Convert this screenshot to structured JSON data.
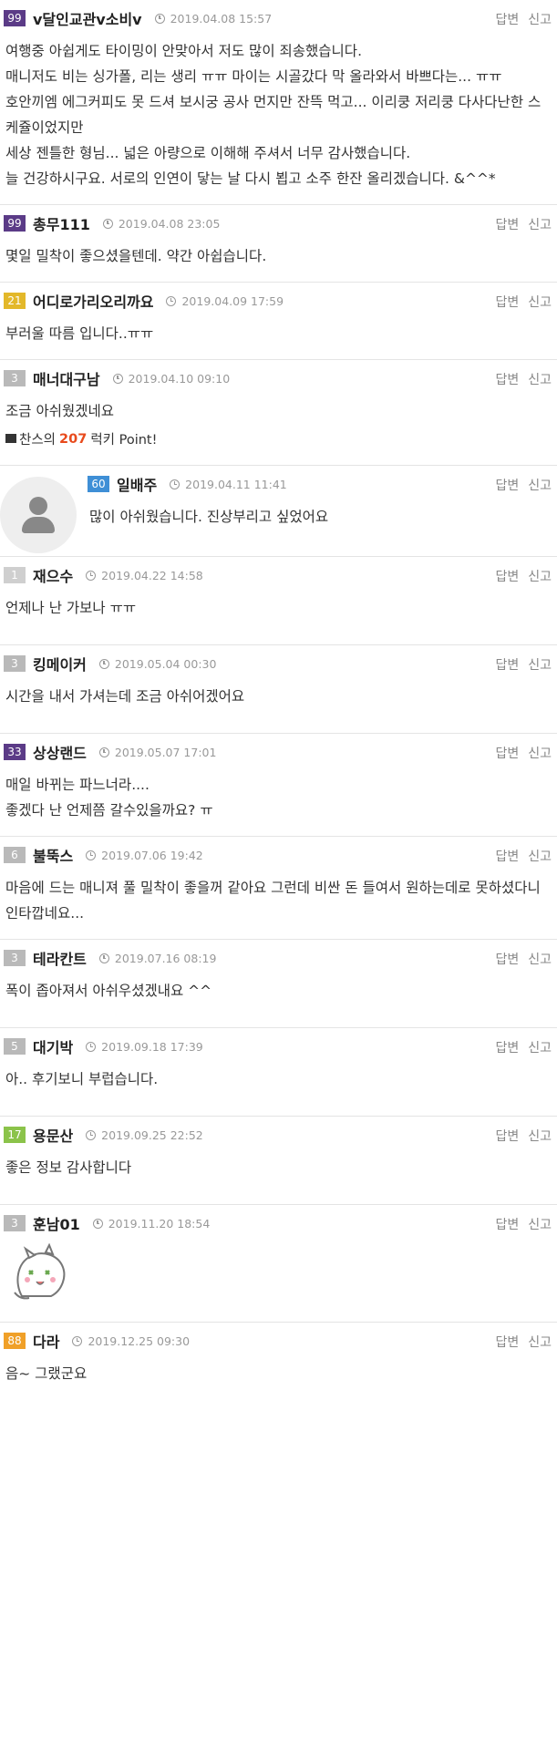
{
  "actions": {
    "reply": "답변",
    "report": "신고"
  },
  "comments": [
    {
      "level": "99",
      "nick": "v달인교관v소비v",
      "time": "2019.04.08 15:57",
      "lines": [
        "여행중 아쉽게도 타이밍이 안맞아서 저도 많이 죄송했습니다.",
        "매니저도 비는 싱가폴, 리는 생리 ㅠㅠ 마이는 시골갔다 막 올라와서 바쁘다는... ㅠㅠ",
        "호안끼엠 에그커피도 못 드셔 보시궁 공사 먼지만 잔뜩 먹고... 이리쿵 저리쿵 다사다난한 스케쥴이었지만",
        "세상 젠틀한 형님... 넓은 아량으로 이해해 주셔서 너무 감사했습니다.",
        "늘 건강하시구요. 서로의 인연이 닿는 날 다시 뵙고 소주 한잔 올리겠습니다. &^^*"
      ]
    },
    {
      "level": "99",
      "nick": "총무111",
      "time": "2019.04.08 23:05",
      "lines": [
        "몇일 밀착이 좋으셨을텐데. 약간 아쉽습니다."
      ]
    },
    {
      "level": "21",
      "nick": "어디로가리오리까요",
      "time": "2019.04.09 17:59",
      "lines": [
        "부러울 따름 입니다..ㅠㅠ"
      ]
    },
    {
      "level": "3",
      "nick": "매너대구남",
      "time": "2019.04.10 09:10",
      "lines": [
        "조금 아쉬웠겠네요"
      ],
      "lucky": {
        "prefix": "찬스의",
        "number": "207",
        "suffix": "럭키 Point!"
      }
    },
    {
      "level": "60",
      "nick": "일배주",
      "time": "2019.04.11 11:41",
      "lines": [
        "많이 아쉬웠습니다. 진상부리고 싶었어요"
      ]
    },
    {
      "level": "1",
      "nick": "재으수",
      "time": "2019.04.22 14:58",
      "lines": [
        "언제나 난 가보나 ㅠㅠ"
      ]
    },
    {
      "level": "3",
      "nick": "킹메이커",
      "time": "2019.05.04 00:30",
      "lines": [
        "시간을 내서 가셔는데 조금 아쉬어겠어요"
      ]
    },
    {
      "level": "33",
      "nick": "상상랜드",
      "time": "2019.05.07 17:01",
      "lines": [
        "매일 바뀌는 파느너라....",
        "좋겠다 난 언제쯤 갈수있을까요? ㅠ"
      ]
    },
    {
      "level": "6",
      "nick": "불뚝스",
      "time": "2019.07.06 19:42",
      "lines": [
        "마음에 드는 매니져 풀 밀착이 좋을꺼 같아요   그런데 비싼 돈 들여서   원하는데로 못하셨다니   인타깝네요..."
      ]
    },
    {
      "level": "3",
      "nick": "테라칸트",
      "time": "2019.07.16 08:19",
      "lines": [
        "폭이 좁아져서 아쉬우셨겠내요 ^^"
      ]
    },
    {
      "level": "5",
      "nick": "대기박",
      "time": "2019.09.18 17:39",
      "lines": [
        "아.. 후기보니 부럽습니다."
      ]
    },
    {
      "level": "17",
      "nick": "용문산",
      "time": "2019.09.25 22:52",
      "lines": [
        "좋은 정보 감사합니다"
      ]
    },
    {
      "level": "3",
      "nick": "훈남01",
      "time": "2019.11.20 18:54",
      "lines": []
    },
    {
      "level": "88",
      "nick": "다라",
      "time": "2019.12.25 09:30",
      "lines": [
        "음~ 그랬군요"
      ]
    }
  ]
}
